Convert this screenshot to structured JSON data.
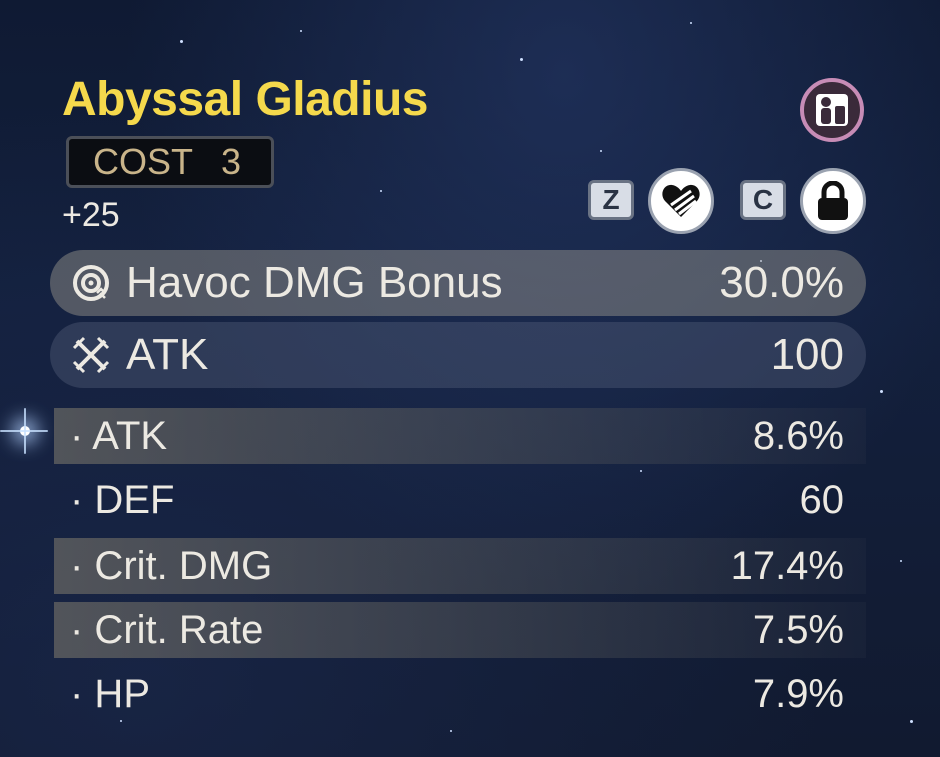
{
  "echo": {
    "name": "Abyssal Gladius",
    "cost_label": "COST",
    "cost_value": "3",
    "level": "+25"
  },
  "controls": {
    "discard_key": "Z",
    "lock_key": "C"
  },
  "main_stats": [
    {
      "icon": "havoc-icon",
      "label": "Havoc DMG Bonus",
      "value": "30.0%"
    },
    {
      "icon": "atk-swords-icon",
      "label": "ATK",
      "value": "100"
    }
  ],
  "sub_stats": [
    {
      "label": "· ATK",
      "value": "8.6%",
      "highlighted": true
    },
    {
      "label": "· DEF",
      "value": "60",
      "highlighted": false
    },
    {
      "label": "· Crit. DMG",
      "value": "17.4%",
      "highlighted": true
    },
    {
      "label": "· Crit. Rate",
      "value": "7.5%",
      "highlighted": true
    },
    {
      "label": "· HP",
      "value": "7.9%",
      "highlighted": false
    }
  ],
  "colors": {
    "title": "#f5d94c",
    "cost_text": "#c9b48a",
    "echo_ring": "#c78cb6",
    "text": "#ece9e2"
  }
}
